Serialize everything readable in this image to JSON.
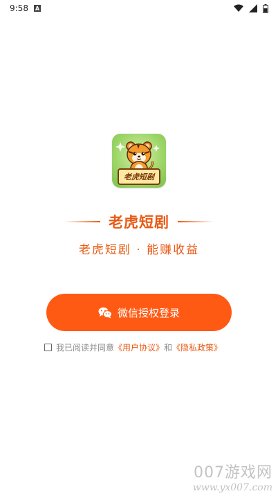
{
  "status_bar": {
    "time": "9:58",
    "notification_icon": "a-badge-icon",
    "icons": [
      "wifi-icon",
      "signal-icon",
      "battery-icon"
    ]
  },
  "app": {
    "icon_label": "老虎短剧",
    "title": "老虎短剧",
    "subtitle": "老虎短剧 · 能赚收益"
  },
  "login": {
    "button_label": "微信授权登录",
    "button_icon": "wechat-icon"
  },
  "agreement": {
    "prefix": "我已阅读并同意",
    "user_agreement": "《用户协议》",
    "and": "和",
    "privacy_policy": "《隐私政策》",
    "checked": false
  },
  "watermark": {
    "line1": "007游戏网",
    "line2": "www.yx007.com"
  },
  "colors": {
    "accent": "#e85a14",
    "button": "#ff5a14"
  }
}
